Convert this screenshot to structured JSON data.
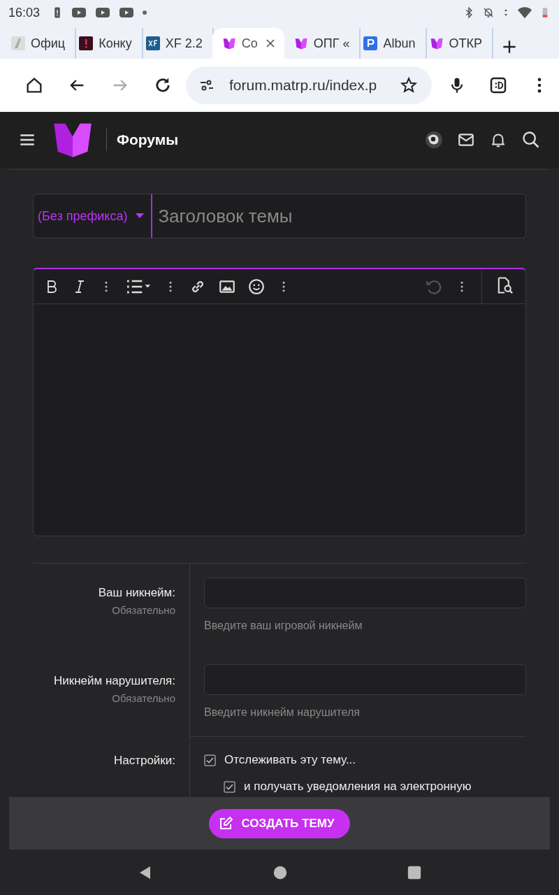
{
  "status_bar": {
    "time": "16:03"
  },
  "browser_tabs": [
    {
      "title": "Офиц",
      "kind": "sketch",
      "selected": false
    },
    {
      "title": "Конку",
      "kind": "alert",
      "selected": false
    },
    {
      "title": "XF 2.2",
      "kind": "xf",
      "selected": false
    },
    {
      "title": "Co",
      "kind": "m",
      "selected": true
    },
    {
      "title": "ОПГ «",
      "kind": "m",
      "selected": false
    },
    {
      "title": "Albun",
      "kind": "p",
      "selected": false
    },
    {
      "title": "ОТКР",
      "kind": "m",
      "selected": false
    }
  ],
  "toolbar": {
    "forward_disabled": true,
    "url": "forum.matrp.ru/index.p"
  },
  "forum_header": {
    "title": "Форумы"
  },
  "thread": {
    "prefix": "(Без префикса)",
    "title_placeholder": "Заголовок темы"
  },
  "editor": {
    "undo_disabled": true
  },
  "fields": [
    {
      "label": "Ваш никнейм:",
      "hint": "Обязательно",
      "help": "Введите ваш игровой никнейм"
    },
    {
      "label": "Никнейм нарушителя:",
      "hint": "Обязательно",
      "help": "Введите никнейм нарушителя"
    }
  ],
  "settings": {
    "label": "Настройки:",
    "options": [
      {
        "label": "Отслеживать эту тему...",
        "checked": true,
        "children": [
          {
            "label": "и получать уведомления на электронную",
            "checked": true
          }
        ]
      }
    ]
  },
  "submit": {
    "label": "СОЗДАТЬ ТЕМУ"
  }
}
